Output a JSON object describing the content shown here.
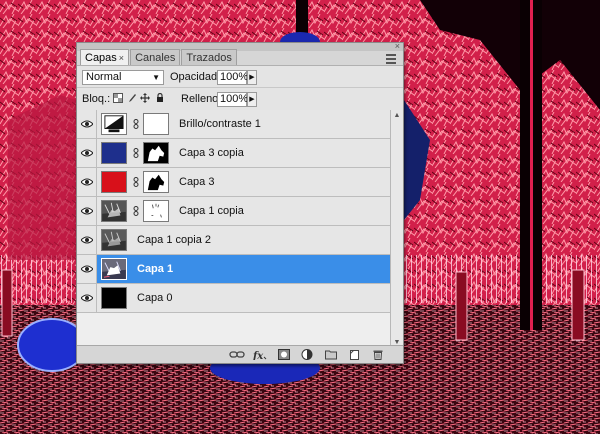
{
  "panel": {
    "tabs": [
      {
        "label": "Capas",
        "active": true,
        "close": "×"
      },
      {
        "label": "Canales",
        "active": false
      },
      {
        "label": "Trazados",
        "active": false
      }
    ],
    "close_glyph": "×"
  },
  "options": {
    "blend_mode": "Normal",
    "opacity_label": "Opacidad:",
    "opacity_value": "100%",
    "lock_label": "Bloq.:",
    "fill_label": "Relleno:",
    "fill_value": "100%"
  },
  "layers": [
    {
      "name": "Brillo/contraste 1",
      "thumb": "adjustment-brightness",
      "mask": "white",
      "selected": false
    },
    {
      "name": "Capa 3 copia",
      "thumb": "solid",
      "thumb_color": "#1e2f8c",
      "mask": "dog-silhouette",
      "selected": false
    },
    {
      "name": "Capa 3",
      "thumb": "solid",
      "thumb_color": "#d8101a",
      "mask": "dog-silhouette",
      "selected": false
    },
    {
      "name": "Capa 1 copia",
      "thumb": "photo-gray",
      "mask": "white-sparse",
      "selected": false
    },
    {
      "name": "Capa 1 copia 2",
      "thumb": "photo-gray",
      "mask": null,
      "selected": false
    },
    {
      "name": "Capa 1",
      "thumb": "photo-color",
      "mask": null,
      "selected": true
    },
    {
      "name": "Capa 0",
      "thumb": "solid",
      "thumb_color": "#000000",
      "mask": null,
      "selected": false
    }
  ],
  "icons": {
    "visibility": "eye-icon",
    "bottom": [
      "link-layers-icon",
      "fx-icon",
      "add-mask-icon",
      "adjustment-layer-icon",
      "group-folder-icon",
      "new-layer-icon",
      "trash-icon"
    ]
  },
  "colors": {
    "selection": "#3a8ee8",
    "panel": "#d6d6d6"
  }
}
